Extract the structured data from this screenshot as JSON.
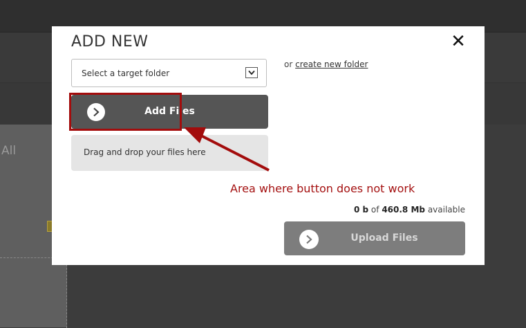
{
  "background": {
    "partial_label": "All"
  },
  "modal": {
    "title": "ADD NEW",
    "close_symbol": "✕",
    "folder_select": {
      "selected": "Select a target folder"
    },
    "or_text": "or",
    "create_folder_link": "create new folder",
    "add_files_label": "Add Files",
    "dropzone_text": "Drag and drop your files here",
    "storage": {
      "used": "0 b",
      "of": "of",
      "total": "460.8 Mb",
      "suffix": "available"
    },
    "upload_files_label": "Upload Files"
  },
  "annotation": {
    "text": "Area where button does not work",
    "color": "#a30c0c"
  },
  "icons": [
    "chevron-right-icon",
    "chevron-down-icon",
    "close-icon"
  ]
}
